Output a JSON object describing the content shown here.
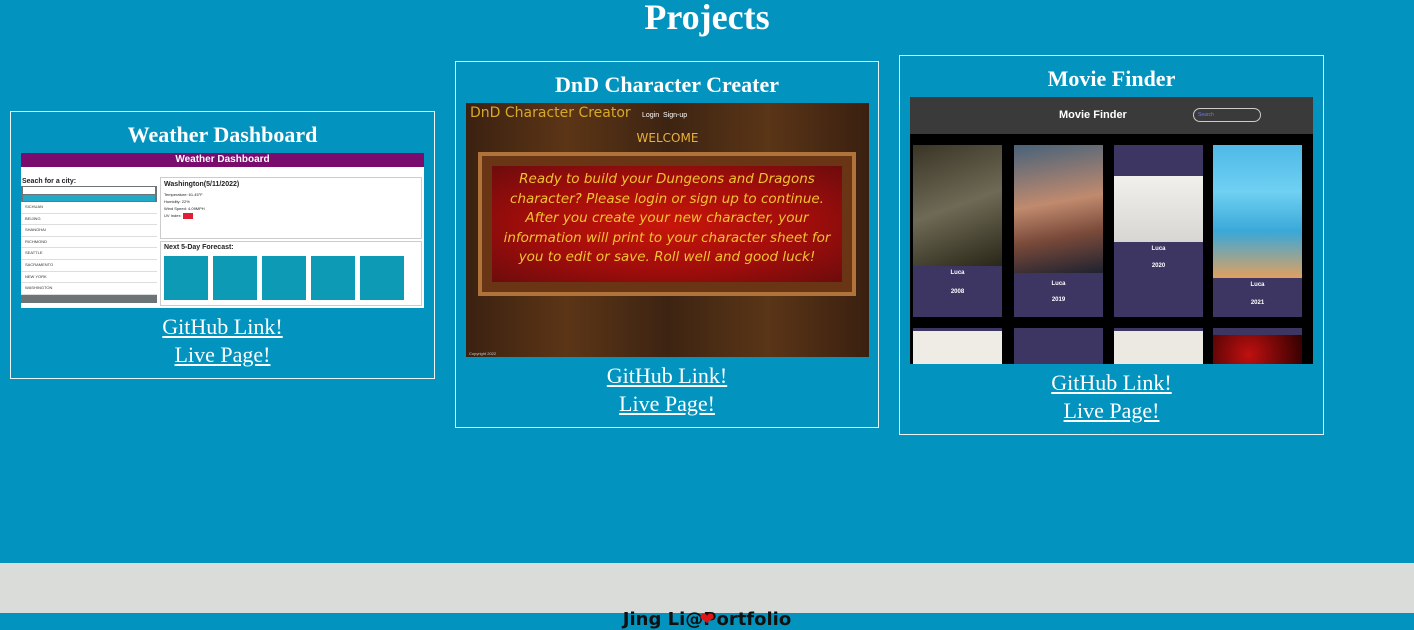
{
  "page": {
    "title": "Projects"
  },
  "projects": [
    {
      "title": "Weather Dashboard",
      "github_label": "GitHub Link!",
      "live_label": "Live Page!",
      "thumbnail": {
        "header": "Weather Dashboard",
        "search_label": "Seach for a city:",
        "search_button": "One Search History",
        "history": [
          "SICHUAN",
          "BEIJING",
          "SHANGHAI",
          "RICHMOND",
          "SEATTLE",
          "SACRAMENTO",
          "NEW YORK",
          "WASHINGTON"
        ],
        "city": "Washington(5/11/2022)",
        "temp": "Temperature: 61.45°F",
        "humidity": "Humidity: 22%",
        "wind": "Wind Speed: 4.09MPH",
        "uv": "UV Index:",
        "uv_value": "3.63",
        "forecast_title": "Next 5-Day Forecast:"
      }
    },
    {
      "title": "DnD Character Creater",
      "github_label": "GitHub Link!",
      "live_label": "Live Page!",
      "thumbnail": {
        "app_title": "DnD Character Creator",
        "nav_login": "Login",
        "nav_signup": "Sign-up",
        "welcome": "WELCOME",
        "message": "Ready to build your Dungeons and Dragons character? Please login or sign up to continue. After you create your new character, your information will print to your character sheet for you to edit or save. Roll well and good luck!",
        "footer": "Copyright 2022"
      }
    },
    {
      "title": "Movie Finder",
      "github_label": "GitHub Link!",
      "live_label": "Live Page!",
      "thumbnail": {
        "app_title": "Movie Finder",
        "search_placeholder": "Search",
        "movies": [
          {
            "name": "Luca",
            "year": "2008"
          },
          {
            "name": "Luca",
            "year": "2019"
          },
          {
            "name": "Luca",
            "year": "2020"
          },
          {
            "name": "Luca",
            "year": "2021"
          }
        ]
      }
    }
  ],
  "footer": {
    "text": "Jing Li@Portfolio",
    "icon": "heart-icon"
  },
  "colors": {
    "background": "#0294bf",
    "footer_bg": "#d9dcd8",
    "heart": "#e01515"
  }
}
